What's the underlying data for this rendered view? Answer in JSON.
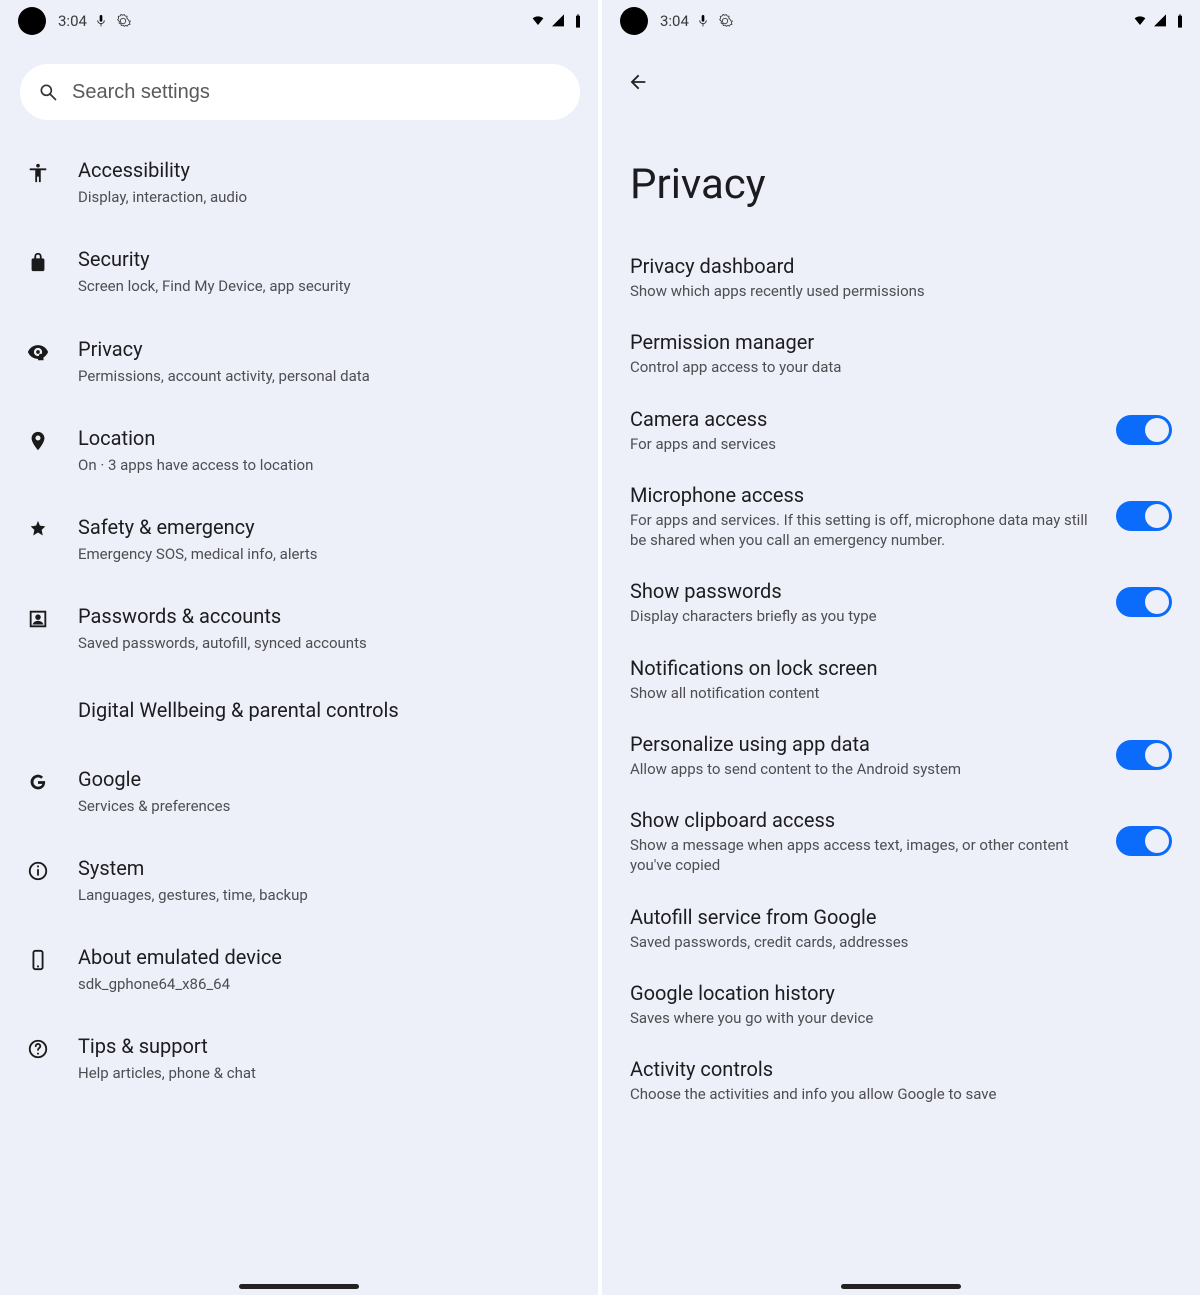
{
  "statusbar": {
    "time": "3:04"
  },
  "left": {
    "search_placeholder": "Search settings",
    "items": [
      {
        "icon": "accessibility",
        "title": "Accessibility",
        "sub": "Display, interaction, audio"
      },
      {
        "icon": "lock",
        "title": "Security",
        "sub": "Screen lock, Find My Device, app security"
      },
      {
        "icon": "privacy",
        "title": "Privacy",
        "sub": "Permissions, account activity, personal data"
      },
      {
        "icon": "location",
        "title": "Location",
        "sub": "On · 3 apps have access to location"
      },
      {
        "icon": "medical",
        "title": "Safety & emergency",
        "sub": "Emergency SOS, medical info, alerts"
      },
      {
        "icon": "account",
        "title": "Passwords & accounts",
        "sub": "Saved passwords, autofill, synced accounts"
      },
      {
        "icon": "",
        "title": "Digital Wellbeing & parental controls",
        "sub": ""
      },
      {
        "icon": "google",
        "title": "Google",
        "sub": "Services & preferences"
      },
      {
        "icon": "info",
        "title": "System",
        "sub": "Languages, gestures, time, backup"
      },
      {
        "icon": "device",
        "title": "About emulated device",
        "sub": "sdk_gphone64_x86_64"
      },
      {
        "icon": "help",
        "title": "Tips & support",
        "sub": "Help articles, phone & chat"
      }
    ]
  },
  "right": {
    "title": "Privacy",
    "items": [
      {
        "title": "Privacy dashboard",
        "sub": "Show which apps recently used permissions",
        "toggle": null
      },
      {
        "title": "Permission manager",
        "sub": "Control app access to your data",
        "toggle": null
      },
      {
        "title": "Camera access",
        "sub": "For apps and services",
        "toggle": true
      },
      {
        "title": "Microphone access",
        "sub": "For apps and services. If this setting is off, microphone data may still be shared when you call an emergency number.",
        "toggle": true
      },
      {
        "title": "Show passwords",
        "sub": "Display characters briefly as you type",
        "toggle": true
      },
      {
        "title": "Notifications on lock screen",
        "sub": "Show all notification content",
        "toggle": null
      },
      {
        "title": "Personalize using app data",
        "sub": "Allow apps to send content to the Android system",
        "toggle": true
      },
      {
        "title": "Show clipboard access",
        "sub": "Show a message when apps access text, images, or other content you've copied",
        "toggle": true
      },
      {
        "title": "Autofill service from Google",
        "sub": "Saved passwords, credit cards, addresses",
        "toggle": null
      },
      {
        "title": "Google location history",
        "sub": "Saves where you go with your device",
        "toggle": null
      },
      {
        "title": "Activity controls",
        "sub": "Choose the activities and info you allow Google to save",
        "toggle": null
      }
    ]
  }
}
